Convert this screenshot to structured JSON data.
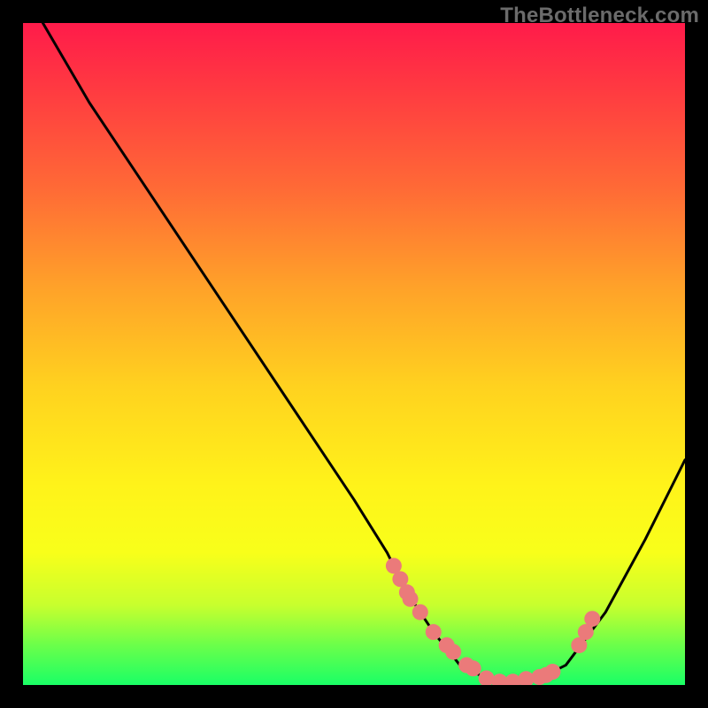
{
  "watermark": "TheBottleneck.com",
  "chart_data": {
    "type": "line",
    "title": "",
    "xlabel": "",
    "ylabel": "",
    "xlim": [
      0,
      100
    ],
    "ylim": [
      0,
      100
    ],
    "x": [
      3,
      10,
      20,
      30,
      40,
      50,
      55,
      58,
      62,
      66,
      70,
      74,
      78,
      82,
      88,
      94,
      100
    ],
    "values": [
      100,
      88,
      73,
      58,
      43,
      28,
      20,
      14,
      8,
      3,
      1,
      0.5,
      1,
      3,
      11,
      22,
      34
    ],
    "markers": {
      "x": [
        56,
        57,
        58,
        58.5,
        60,
        62,
        64,
        65,
        67,
        68,
        70,
        72,
        74,
        76,
        78,
        79,
        80,
        84,
        85,
        86
      ],
      "values": [
        18,
        16,
        14,
        13,
        11,
        8,
        6,
        5,
        3,
        2.5,
        1,
        0.5,
        0.5,
        0.9,
        1.2,
        1.5,
        2,
        6,
        8,
        10
      ]
    },
    "colors": {
      "line": "#000000",
      "marker": "#eb7a7a"
    }
  }
}
